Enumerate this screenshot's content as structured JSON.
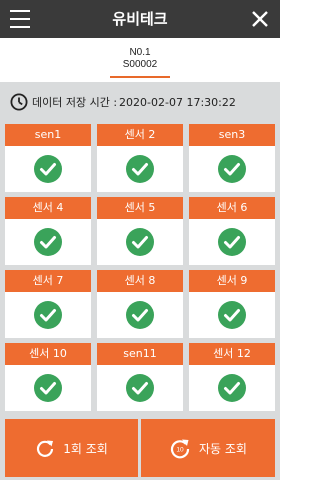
{
  "header": {
    "title": "유비테크",
    "menu_icon": "hamburger-menu-icon",
    "close_icon": "close-icon"
  },
  "device": {
    "line1": "N0.1",
    "line2": "S00002"
  },
  "save_time": {
    "label": "데이터 저장 시간 :",
    "value": "2020-02-07 17:30:22"
  },
  "sensors": [
    {
      "name": "sen1",
      "status": "ok"
    },
    {
      "name": "센서 2",
      "status": "ok"
    },
    {
      "name": "sen3",
      "status": "ok"
    },
    {
      "name": "센서 4",
      "status": "ok"
    },
    {
      "name": "센서 5",
      "status": "ok"
    },
    {
      "name": "센서 6",
      "status": "ok"
    },
    {
      "name": "센서 7",
      "status": "ok"
    },
    {
      "name": "센서 8",
      "status": "ok"
    },
    {
      "name": "센서 9",
      "status": "ok"
    },
    {
      "name": "센서 10",
      "status": "ok"
    },
    {
      "name": "sen11",
      "status": "ok"
    },
    {
      "name": "센서 12",
      "status": "ok"
    }
  ],
  "buttons": {
    "once": "1회 조회",
    "auto": "자동 조회"
  },
  "colors": {
    "accent": "#ee6c30",
    "header_bg": "#3a3a3a",
    "ok_green": "#3aa35a",
    "content_bg": "#d9dbdc"
  }
}
